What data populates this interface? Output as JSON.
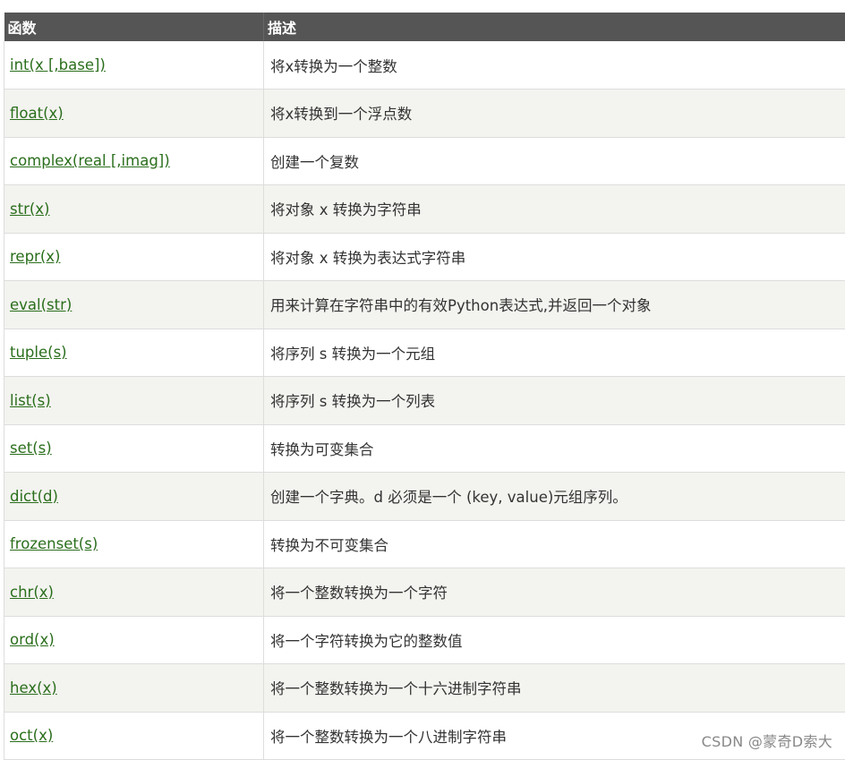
{
  "table": {
    "headers": [
      "函数",
      "描述"
    ],
    "rows": [
      {
        "function": "int(x [,base])",
        "description": "将x转换为一个整数"
      },
      {
        "function": "float(x)",
        "description": "将x转换到一个浮点数"
      },
      {
        "function": "complex(real [,imag])",
        "description": "创建一个复数"
      },
      {
        "function": "str(x)",
        "description": "将对象 x 转换为字符串"
      },
      {
        "function": "repr(x)",
        "description": "将对象 x 转换为表达式字符串"
      },
      {
        "function": "eval(str)",
        "description": "用来计算在字符串中的有效Python表达式,并返回一个对象"
      },
      {
        "function": "tuple(s)",
        "description": "将序列 s 转换为一个元组"
      },
      {
        "function": "list(s)",
        "description": "将序列 s 转换为一个列表"
      },
      {
        "function": "set(s)",
        "description": "转换为可变集合"
      },
      {
        "function": "dict(d)",
        "description": "创建一个字典。d 必须是一个 (key, value)元组序列。"
      },
      {
        "function": "frozenset(s)",
        "description": "转换为不可变集合"
      },
      {
        "function": "chr(x)",
        "description": "将一个整数转换为一个字符"
      },
      {
        "function": "ord(x)",
        "description": "将一个字符转换为它的整数值"
      },
      {
        "function": "hex(x)",
        "description": "将一个整数转换为一个十六进制字符串"
      },
      {
        "function": "oct(x)",
        "description": "将一个整数转换为一个八进制字符串"
      }
    ]
  },
  "watermark": "CSDN @蒙奇D索大",
  "colors": {
    "header_bg": "#555555",
    "header_text": "#ffffff",
    "link": "#2a6e1c",
    "row_alt": "#f3f3ef"
  }
}
